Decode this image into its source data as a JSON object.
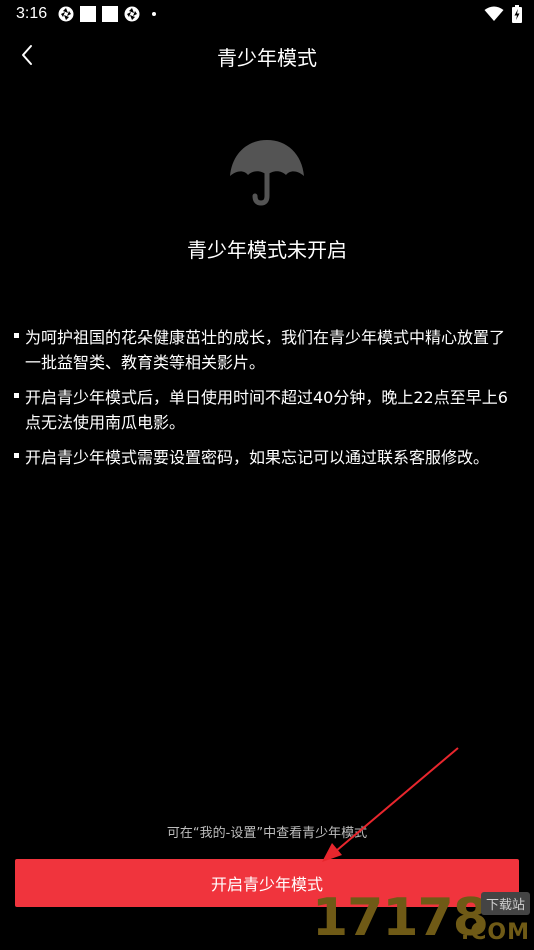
{
  "status_bar": {
    "time": "3:16"
  },
  "header": {
    "title": "青少年模式"
  },
  "main": {
    "heading": "青少年模式未开启",
    "rules": [
      "为呵护祖国的花朵健康茁壮的成长，我们在青少年模式中精心放置了一批益智类、教育类等相关影片。",
      "开启青少年模式后，单日使用时间不超过40分钟，晚上22点至早上6点无法使用南瓜电影。",
      "开启青少年模式需要设置密码，如果忘记可以通过联系客服修改。"
    ]
  },
  "footer": {
    "hint": "可在“我的-设置”中查看青少年模式",
    "open_button_label": "开启青少年模式"
  },
  "watermark": {
    "number": "17178",
    "tag": "下载站",
    "domain": ".COM"
  },
  "colors": {
    "background": "#000000",
    "accent": "#f0343d",
    "icon": "#545454",
    "annotation_arrow": "#e8262d"
  },
  "icons": {
    "back": "chevron-left-icon",
    "main": "umbrella-icon"
  }
}
